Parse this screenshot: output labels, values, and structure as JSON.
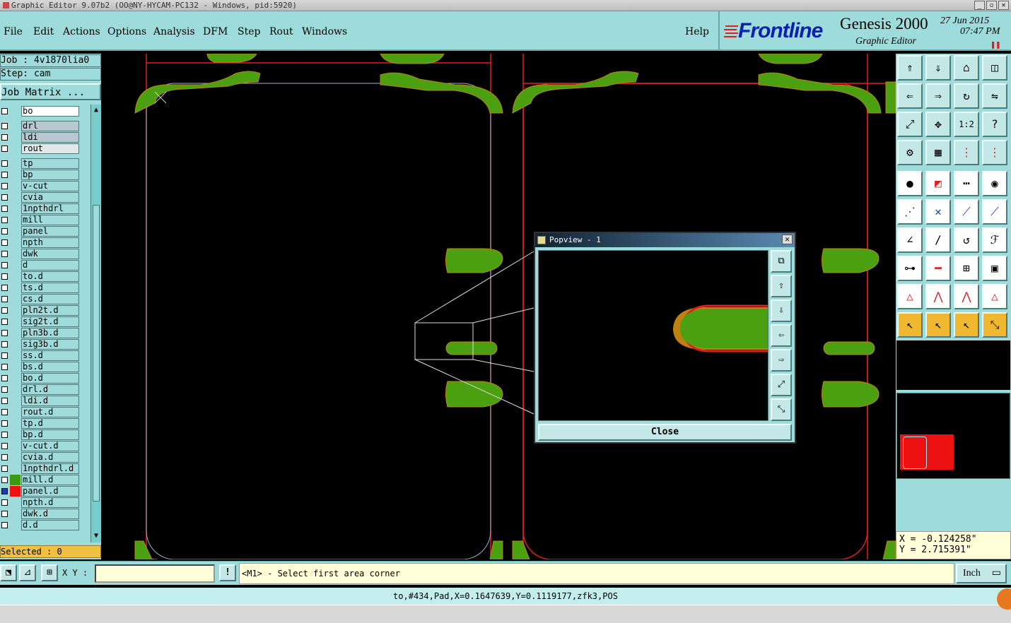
{
  "window": {
    "title": "Graphic Editor 9.07b2 (OO@NY-HYCAM-PC132 - Windows, pid:5920)"
  },
  "menu": {
    "items": [
      "File",
      "Edit",
      "Actions",
      "Options",
      "Analysis",
      "DFM",
      "Step",
      "Rout",
      "Windows"
    ],
    "help": "Help"
  },
  "brand": {
    "logo": "Frontline",
    "product": "Genesis 2000",
    "subtitle": "Graphic Editor",
    "date": "27 Jun 2015",
    "time": "07:47 PM",
    "colors": {
      "logo": "#0b1fb0",
      "accent": "#e02020",
      "panel": "#9edcdc"
    }
  },
  "job": {
    "job_label": "Job : 4v1870lia0",
    "step_label": "Step: cam",
    "matrix_button": "Job Matrix ..."
  },
  "layers": [
    {
      "name": "bo",
      "color": "",
      "style": "white"
    },
    {
      "name": "drl",
      "color": "",
      "style": "grey"
    },
    {
      "name": "ldi",
      "color": "",
      "style": "grey"
    },
    {
      "name": "rout",
      "color": "",
      "style": "light"
    },
    {
      "name": "tp",
      "color": ""
    },
    {
      "name": "bp",
      "color": ""
    },
    {
      "name": "v-cut",
      "color": ""
    },
    {
      "name": "cvia",
      "color": ""
    },
    {
      "name": "1npthdrl",
      "color": ""
    },
    {
      "name": "mill",
      "color": ""
    },
    {
      "name": "panel",
      "color": ""
    },
    {
      "name": "npth",
      "color": ""
    },
    {
      "name": "dwk",
      "color": ""
    },
    {
      "name": "d",
      "color": ""
    },
    {
      "name": "to.d",
      "color": ""
    },
    {
      "name": "ts.d",
      "color": ""
    },
    {
      "name": "cs.d",
      "color": ""
    },
    {
      "name": "pln2t.d",
      "color": ""
    },
    {
      "name": "sig2t.d",
      "color": ""
    },
    {
      "name": "pln3b.d",
      "color": ""
    },
    {
      "name": "sig3b.d",
      "color": ""
    },
    {
      "name": "ss.d",
      "color": ""
    },
    {
      "name": "bs.d",
      "color": ""
    },
    {
      "name": "bo.d",
      "color": ""
    },
    {
      "name": "drl.d",
      "color": ""
    },
    {
      "name": "ldi.d",
      "color": ""
    },
    {
      "name": "rout.d",
      "color": ""
    },
    {
      "name": "tp.d",
      "color": ""
    },
    {
      "name": "bp.d",
      "color": ""
    },
    {
      "name": "v-cut.d",
      "color": ""
    },
    {
      "name": "cvia.d",
      "color": ""
    },
    {
      "name": "1npthdrl.d",
      "color": ""
    },
    {
      "name": "mill.d",
      "color": "#3a9a10"
    },
    {
      "name": "panel.d",
      "color": "#ee1111",
      "active": true
    },
    {
      "name": "npth.d",
      "color": ""
    },
    {
      "name": "dwk.d",
      "color": ""
    },
    {
      "name": "d.d",
      "color": ""
    }
  ],
  "selected": "Selected : 0",
  "popview": {
    "title": "Popview - 1",
    "close_label": "Close"
  },
  "coords": {
    "x": "X = -0.124258\"",
    "y": "Y =  2.715391\""
  },
  "command": {
    "xy_label": "X Y :",
    "xy_value": "",
    "prompt": "<M1> - Select first area corner",
    "units": "Inch"
  },
  "status": "to,#434,Pad,X=0.1647639,Y=0.1119177,zfk3,POS",
  "toolbar_icons": [
    "snap-to-top-icon",
    "snap-to-bottom-icon",
    "home-icon",
    "split-view-icon",
    "snap-left-icon",
    "snap-right-icon",
    "rotate-icon",
    "mirror-icon",
    "zoom-fit-icon",
    "zoom-center-icon",
    "scale-1-2-icon",
    "help-query-icon",
    "settings-icon",
    "grid-icon",
    "layer-compare-icon",
    "layer-compare-alt-icon",
    "pad-icon",
    "feature-red-icon",
    "ruler-icon",
    "circle-icon",
    "connect-icon",
    "cross-icon",
    "line-node-icon",
    "line-node-alt-icon",
    "angle-icon",
    "slash-icon",
    "arc-icon",
    "fix-icon",
    "move-icon",
    "line-red-icon",
    "measure-icon",
    "blocks-icon",
    "triangle-icon",
    "triangle-alt-icon",
    "triangle-open-icon",
    "triangle-cut-icon",
    "pointer-icon",
    "pointer-select-icon",
    "pointer-area-icon",
    "pointer-route-icon"
  ]
}
